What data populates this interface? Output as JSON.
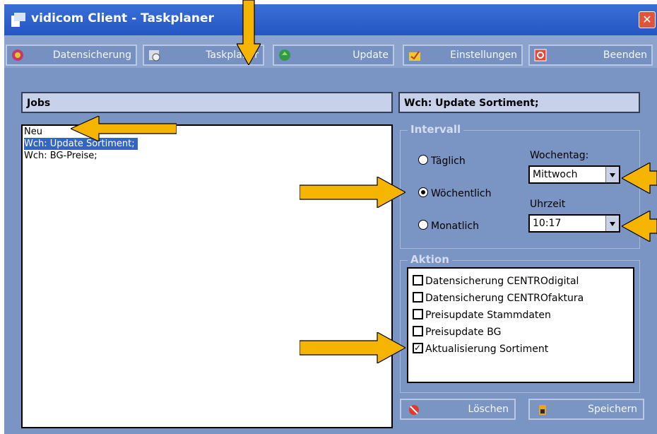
{
  "window": {
    "title": "vidicom Client - Taskplaner",
    "close_glyph": "✕"
  },
  "toolbar": {
    "datensicherung": "Datensicherung",
    "taskplaner": "Taskplaner",
    "update": "Update",
    "einstellungen": "Einstellungen",
    "beenden": "Beenden"
  },
  "jobs": {
    "header": "Jobs",
    "items": [
      "Neu",
      "Wch: Update Sortiment;",
      "Wch: BG-Preise;"
    ],
    "selected_index": 1
  },
  "detail": {
    "header": "Wch: Update Sortiment;",
    "intervall": {
      "title": "Intervall",
      "options": [
        "Täglich",
        "Wöchentlich",
        "Monatlich"
      ],
      "selected": "Wöchentlich",
      "wochentag_label": "Wochentag:",
      "wochentag_value": "Mittwoch",
      "uhrzeit_label": "Uhrzeit",
      "uhrzeit_value": "10:17"
    },
    "aktion": {
      "title": "Aktion",
      "items": [
        {
          "label": "Datensicherung CENTROdigital",
          "checked": false
        },
        {
          "label": "Datensicherung CENTROfaktura",
          "checked": false
        },
        {
          "label": "Preisupdate Stammdaten",
          "checked": false
        },
        {
          "label": "Preisupdate BG",
          "checked": false
        },
        {
          "label": "Aktualisierung Sortiment",
          "checked": true
        }
      ]
    }
  },
  "buttons": {
    "loeschen": "Löschen",
    "speichern": "Speichern"
  },
  "colors": {
    "arrow": "#f5b400",
    "selection": "#3265c4",
    "titlebar": "#2456c4"
  },
  "icons": [
    "app-icon",
    "close-icon",
    "datensicherung-icon",
    "taskplaner-icon",
    "update-icon",
    "einstellungen-icon",
    "beenden-icon",
    "loeschen-icon",
    "speichern-icon",
    "dropdown-arrow-icon"
  ]
}
